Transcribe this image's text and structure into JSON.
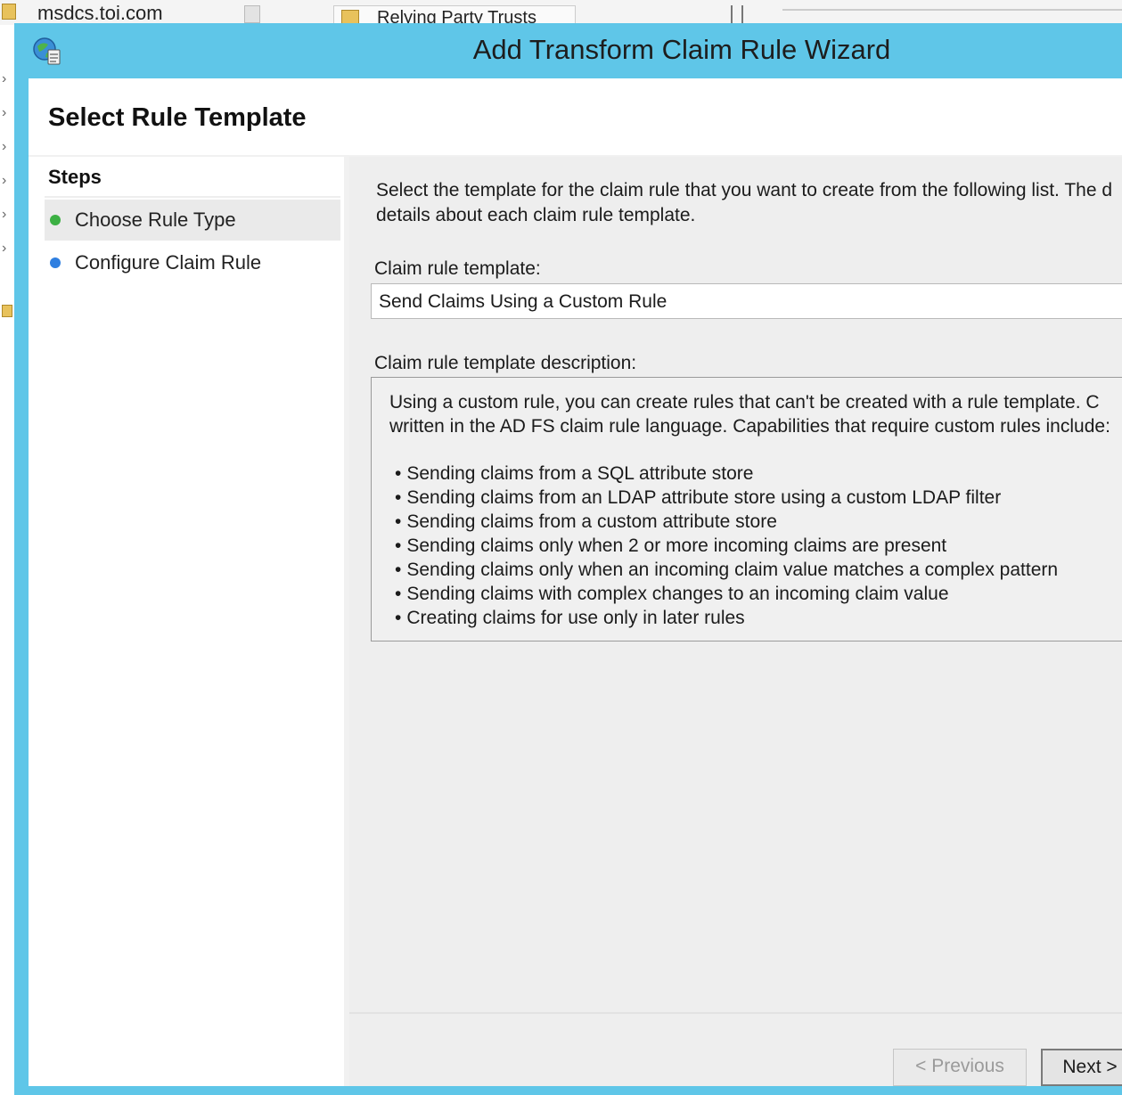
{
  "background": {
    "host_label": "msdcs.toi.com",
    "tab_label": "Relying Party Trusts"
  },
  "wizard": {
    "title": "Add Transform Claim Rule Wizard",
    "page_title": "Select Rule Template",
    "steps": {
      "heading": "Steps",
      "items": [
        {
          "label": "Choose Rule Type",
          "status_color": "#3cb043",
          "active": true
        },
        {
          "label": "Configure Claim Rule",
          "status_color": "#2f7fe0",
          "active": false
        }
      ]
    },
    "content": {
      "intro_line1": "Select the template for the claim rule that you want to create from the following list. The d",
      "intro_line2": "details about each claim rule template.",
      "template_label": "Claim rule template:",
      "template_value": "Send Claims Using a Custom Rule",
      "description_label": "Claim rule template description:",
      "description_line1": "Using a custom rule, you can create rules that can't be created with a rule template.  C",
      "description_line2": "written in the AD FS claim rule language.  Capabilities that require custom rules include:",
      "capabilities": [
        "Sending claims from a SQL attribute store",
        "Sending claims from an LDAP attribute store using a custom LDAP filter",
        "Sending claims from a custom attribute store",
        "Sending claims only when 2 or more incoming claims are present",
        "Sending claims only when an incoming claim value matches a complex pattern",
        "Sending claims with complex changes to an incoming claim value",
        "Creating claims for use only in later rules"
      ]
    },
    "buttons": {
      "previous": "< Previous",
      "next": "Next >"
    }
  },
  "colors": {
    "title_bar": "#5fc6e8",
    "step_done": "#3cb043",
    "step_current": "#2f7fe0"
  }
}
